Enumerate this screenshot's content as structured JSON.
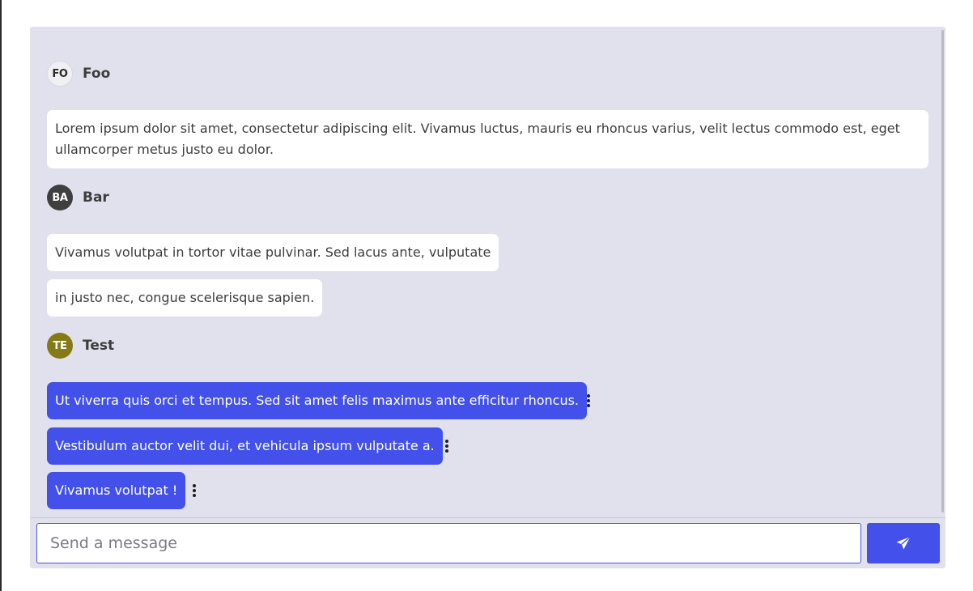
{
  "placeholder_text": "Send a message",
  "colors": {
    "panel_background": "#e1e1ee",
    "own_message": "#4351ea",
    "send_button": "#4351ea",
    "avatar_foo": "#f0f0f4",
    "avatar_bar": "#3f3f3f",
    "avatar_test": "#857a16"
  },
  "groups": [
    {
      "author": "Foo",
      "initials": "FO",
      "messages": [
        "Lorem ipsum dolor sit amet, consectetur adipiscing elit. Vivamus luctus, mauris eu rhoncus varius, velit lectus commodo est, eget ullamcorper metus justo eu dolor."
      ]
    },
    {
      "author": "Bar",
      "initials": "BA",
      "messages": [
        "Vivamus volutpat in tortor vitae pulvinar. Sed lacus ante, vulputate",
        "in justo nec, congue scelerisque sapien."
      ]
    },
    {
      "author": "Test",
      "initials": "TE",
      "messages": [
        "Ut viverra quis orci et tempus. Sed sit amet felis maximus ante efficitur rhoncus.",
        "Vestibulum auctor velit dui, et vehicula ipsum vulputate a.",
        "Vivamus volutpat !"
      ]
    }
  ],
  "icons": {
    "send": "paper-plane-icon",
    "message_menu": "more-vertical-icon"
  }
}
